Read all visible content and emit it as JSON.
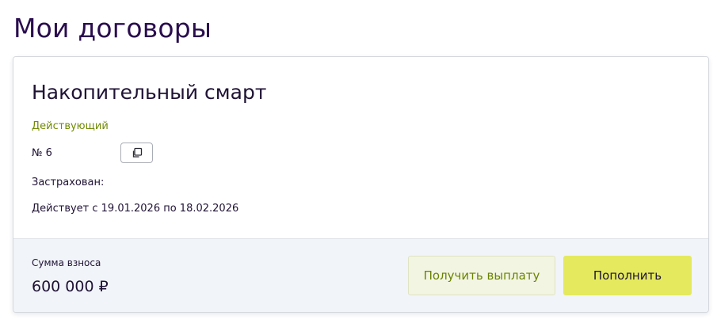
{
  "page": {
    "title": "Мои договоры"
  },
  "contract": {
    "product_name": "Накопительный смарт",
    "status": "Действующий",
    "number_label": "№ 6",
    "copy_icon": "copy-icon",
    "insured_label": "Застрахован:",
    "validity": "Действует с 19.01.2026 по 18.02.2026",
    "amount_label": "Сумма взноса",
    "amount_value": "600 000 ₽",
    "payout_button": "Получить выплату",
    "topup_button": "Пополнить"
  },
  "colors": {
    "title": "#2a0d4e",
    "status_active": "#6f8a00",
    "primary_button": "#e4e95e",
    "secondary_button_bg": "#f3f5e3",
    "secondary_button_text": "#6a8400",
    "card_footer_bg": "#f1f4f8"
  }
}
